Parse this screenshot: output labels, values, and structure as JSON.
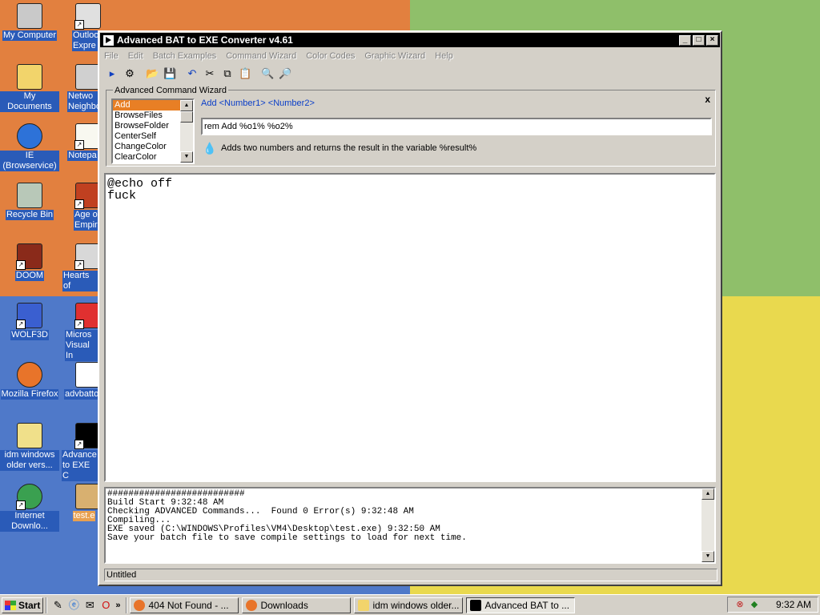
{
  "desktop": {
    "icons": [
      {
        "label": "My Computer"
      },
      {
        "label": "Outlook Expre"
      },
      {
        "label": "My Documents"
      },
      {
        "label": "Netwo Neighbor"
      },
      {
        "label": "IE (Browservice)"
      },
      {
        "label": "Notepa"
      },
      {
        "label": "Recycle Bin"
      },
      {
        "label": "Age o Empir"
      },
      {
        "label": "DOOM"
      },
      {
        "label": "Hearts of"
      },
      {
        "label": "WOLF3D"
      },
      {
        "label": "Micros Visual In"
      },
      {
        "label": "Mozilla Firefox"
      },
      {
        "label": "advbatto"
      },
      {
        "label": "idm windows older vers..."
      },
      {
        "label": "Advance to EXE C"
      },
      {
        "label": "Internet Downlo..."
      },
      {
        "label": "test.e"
      }
    ]
  },
  "window": {
    "title": "Advanced BAT to EXE Converter v4.61",
    "menu": [
      "File",
      "Edit",
      "Batch Examples",
      "Command Wizard",
      "Color Codes",
      "Graphic Wizard",
      "Help"
    ],
    "wizard": {
      "title": "Advanced Command Wizard",
      "close_label": "x",
      "commands": [
        "Add",
        "BrowseFiles",
        "BrowseFolder",
        "CenterSelf",
        "ChangeColor",
        "ClearColor"
      ],
      "selected": "Add",
      "syntax": "Add  <Number1> <Number2>",
      "input_value": "rem Add %o1% %o2%",
      "description": "Adds two numbers and returns the result in the variable %result%"
    },
    "editor": {
      "lines": [
        "@echo off",
        "fuck"
      ]
    },
    "output": {
      "lines": [
        "##########################",
        "Build Start 9:32:48 AM",
        "Checking ADVANCED Commands...  Found 0 Error(s) 9:32:48 AM",
        "Compiling...",
        "EXE saved (C:\\WINDOWS\\Profiles\\VM4\\Desktop\\test.exe) 9:32:50 AM",
        "Save your batch file to save compile settings to load for next time."
      ]
    },
    "status": "Untitled"
  },
  "taskbar": {
    "start_label": "Start",
    "tasks": [
      "404 Not Found - ...",
      "Downloads",
      "idm windows older...",
      "Advanced BAT to ..."
    ],
    "active_task": "Advanced BAT to ...",
    "clock": "9:32 AM"
  }
}
